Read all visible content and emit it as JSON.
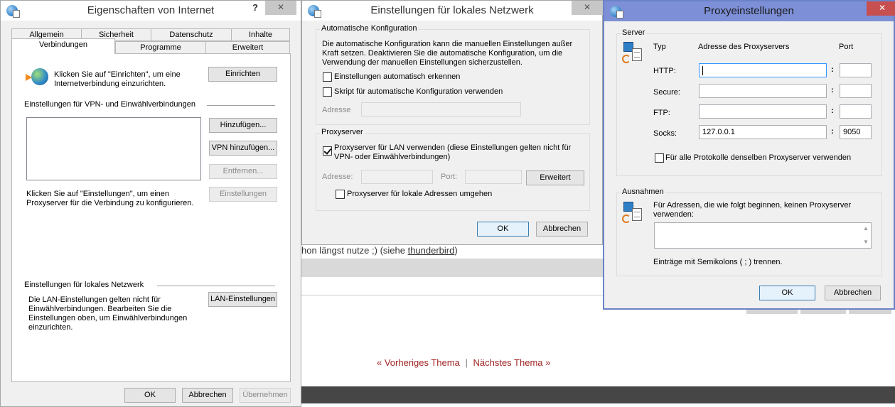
{
  "background_page": {
    "text_prefix": "hon längst nutze ;) (siehe ",
    "text_link": "thunderbird",
    "text_suffix": ")",
    "prev_topic": "« Vorheriges Thema",
    "nav_separator": "|",
    "next_topic": "Nächstes Thema »"
  },
  "internet_options": {
    "title": "Eigenschaften von Internet",
    "help_label": "?",
    "close_label": "✕",
    "tabs_row1": [
      "Allgemein",
      "Sicherheit",
      "Datenschutz",
      "Inhalte"
    ],
    "tabs_row2": [
      "Verbindungen",
      "Programme",
      "Erweitert"
    ],
    "setup_text": "Klicken Sie auf \"Einrichten\", um eine Internetverbindung einzurichten.",
    "setup_button": "Einrichten",
    "vpn_section_label": "Einstellungen für VPN- und Einwählverbindungen",
    "add_button": "Hinzufügen...",
    "add_vpn_button": "VPN hinzufügen...",
    "remove_button": "Entfernen...",
    "settings_button": "Einstellungen",
    "settings_text": "Klicken Sie auf \"Einstellungen\", um einen Proxyserver für die Verbindung zu konfigurieren.",
    "lan_section_label": "Einstellungen für lokales Netzwerk",
    "lan_text": "Die LAN-Einstellungen gelten nicht für Einwählverbindungen. Bearbeiten Sie die Einstellungen oben, um Einwählverbindungen einzurichten.",
    "lan_button": "LAN-Einstellungen",
    "ok_button": "OK",
    "cancel_button": "Abbrechen",
    "apply_button": "Übernehmen"
  },
  "lan_settings": {
    "title": "Einstellungen für lokales Netzwerk",
    "close_label": "✕",
    "auto_group_title": "Automatische Konfiguration",
    "auto_text": "Die automatische Konfiguration kann die manuellen Einstellungen außer Kraft setzen. Deaktivieren Sie die automatische Konfiguration, um die Verwendung der manuellen Einstellungen sicherzustellen.",
    "auto_detect_label": "Einstellungen automatisch erkennen",
    "auto_detect_checked": false,
    "auto_script_label": "Skript für automatische Konfiguration verwenden",
    "auto_script_checked": false,
    "address_label": "Adresse",
    "address_value": "",
    "proxy_group_title": "Proxyserver",
    "use_proxy_label": "Proxyserver für LAN verwenden (diese Einstellungen gelten nicht für VPN- oder Einwählverbindungen)",
    "use_proxy_checked": true,
    "proxy_address_label": "Adresse:",
    "proxy_address_value": "",
    "port_label": "Port:",
    "port_value": "",
    "advanced_button": "Erweitert",
    "bypass_label": "Proxyserver für lokale Adressen umgehen",
    "bypass_checked": false,
    "ok_button": "OK",
    "cancel_button": "Abbrechen"
  },
  "proxy_settings": {
    "title": "Proxyeinstellungen",
    "close_label": "✕",
    "server_group_title": "Server",
    "col_type": "Typ",
    "col_address": "Adresse des Proxyservers",
    "col_port": "Port",
    "rows": [
      {
        "type": "HTTP:",
        "address": "",
        "port": ""
      },
      {
        "type": "Secure:",
        "address": "",
        "port": ""
      },
      {
        "type": "FTP:",
        "address": "",
        "port": ""
      },
      {
        "type": "Socks:",
        "address": "127.0.0.1",
        "port": "9050"
      }
    ],
    "colon": ":",
    "same_proxy_label": "Für alle Protokolle denselben Proxyserver verwenden",
    "same_proxy_checked": false,
    "exceptions_group_title": "Ausnahmen",
    "exceptions_text": "Für Adressen, die wie folgt beginnen, keinen Proxyserver verwenden:",
    "exceptions_value": "",
    "exceptions_hint": "Einträge mit Semikolons ( ; ) trennen.",
    "ok_button": "OK",
    "cancel_button": "Abbrechen"
  }
}
